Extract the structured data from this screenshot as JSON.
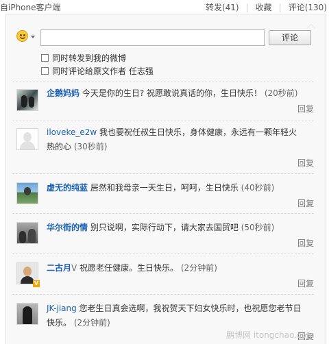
{
  "topbar": {
    "source": "自iPhone客户端",
    "repost": "转发(41)",
    "favorite": "收藏",
    "comment": "评论(130)"
  },
  "composer": {
    "input_value": "",
    "submit_label": "评论",
    "options": [
      "同时转发到我的微博",
      "同时评论给原文作者 任志强"
    ]
  },
  "comments": [
    {
      "user": "企鹅妈妈",
      "text": " 今天是你的生日? 祝愿敢说真话的你，生日快乐！ ",
      "time": "(20秒前)",
      "reply": "回复"
    },
    {
      "user": "iloveke_e2w",
      "text": " 我也要祝任叔生日快乐，身体健康，永远有一颗年轻火热的心 ",
      "time": "(30秒前)",
      "reply": "回复"
    },
    {
      "user": "虚无的纯蓝",
      "text": " 居然和我母亲一天生日，呵呵，生日快乐 ",
      "time": "(40秒前)",
      "reply": "回复"
    },
    {
      "user": "华尔街的情",
      "text": " 别只说啊，实际行动下，请大家去国贸吧 ",
      "time": "(50秒前)",
      "reply": "回复"
    },
    {
      "user": "二古月",
      "badge": "V",
      "text": " 祝愿老任健康。生日快乐。 ",
      "time": "(2分钟前)",
      "reply": "回复"
    },
    {
      "user": "JK-jiang",
      "text": " 您老生日真会选啊，我祝贺天下妇女快乐时，也祝愿您老节日快乐。 ",
      "time": "(2分钟前)",
      "reply": "回复"
    }
  ],
  "watermark": "鹏博网 itongchao.com"
}
